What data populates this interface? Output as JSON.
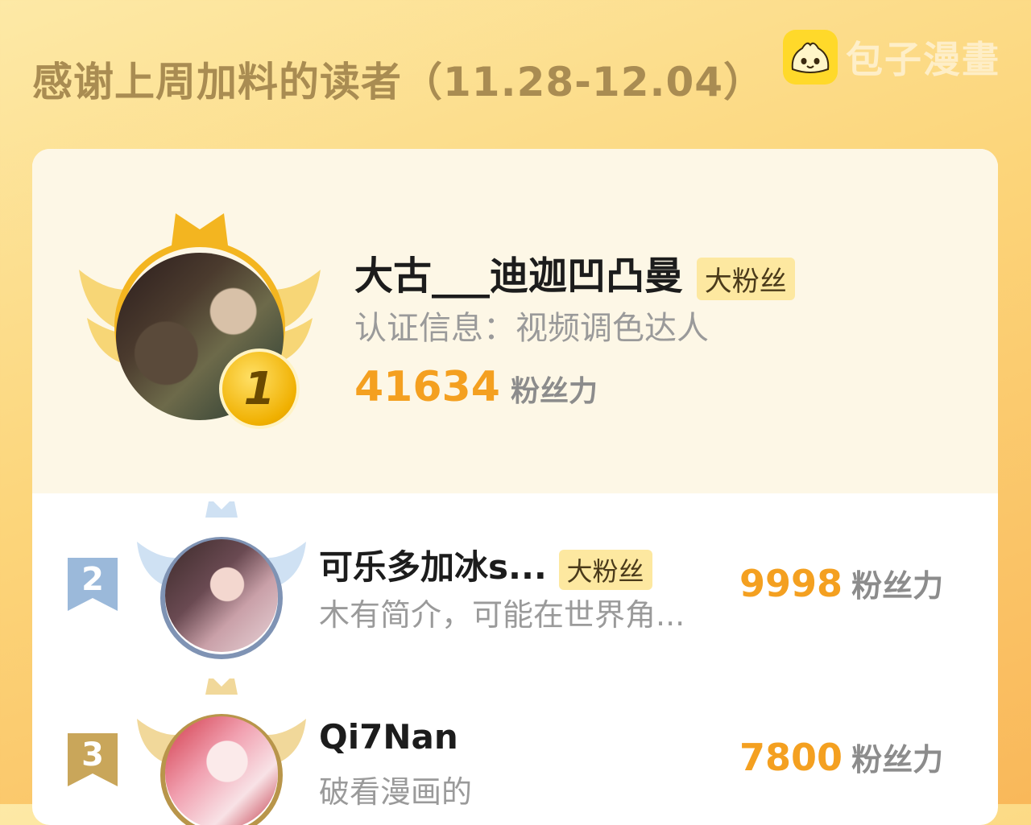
{
  "header": {
    "title": "感谢上周加料的读者（11.28-12.04）",
    "logo_text": "包子漫畫"
  },
  "colors": {
    "accent_number": "#f4a020",
    "badge_bg": "#fde8a0",
    "gold": "#f3b520",
    "silver": "#9bb9da",
    "bronze": "#c9a65a"
  },
  "leaderboard": [
    {
      "rank": "1",
      "name": "大古___迪迦凹凸曼",
      "badge": "大粉丝",
      "desc": "认证信息：视频调色达人",
      "score": "41634",
      "unit": "粉丝力"
    },
    {
      "rank": "2",
      "name": "可乐多加冰s...",
      "badge": "大粉丝",
      "desc": "木有简介，可能在世界角...",
      "score": "9998",
      "unit": "粉丝力"
    },
    {
      "rank": "3",
      "name": "Qi7Nan",
      "desc": "破看漫画的",
      "score": "7800",
      "unit": "粉丝力"
    }
  ]
}
